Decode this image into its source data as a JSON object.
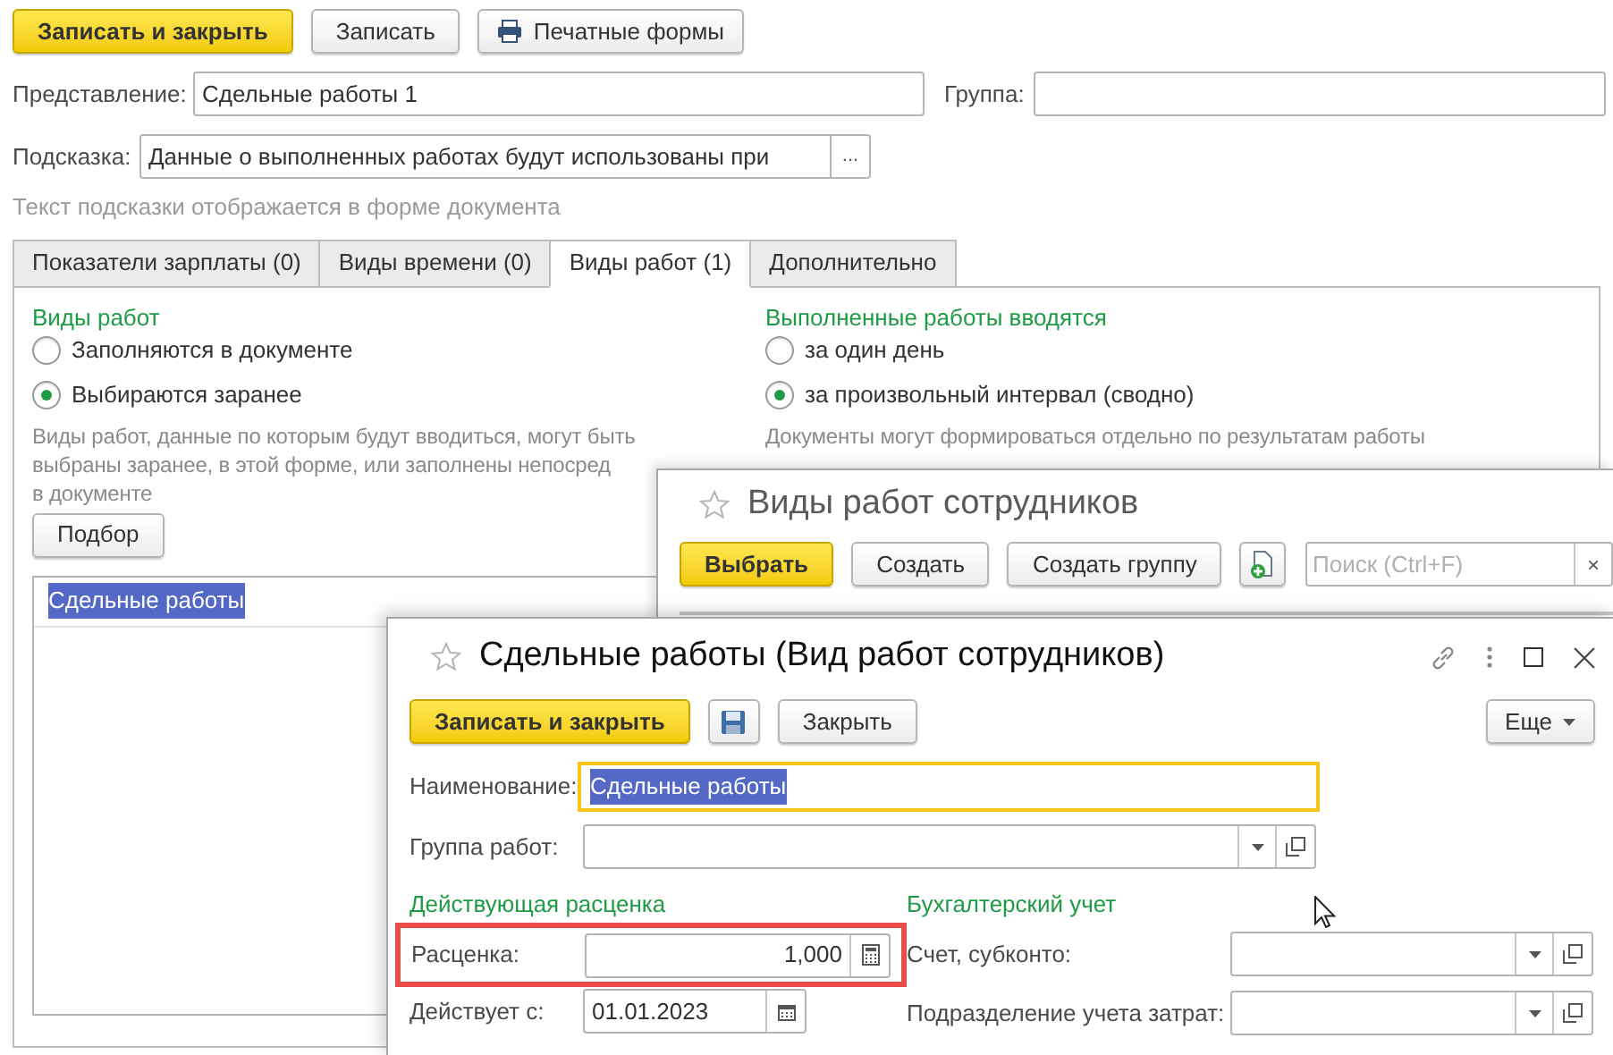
{
  "main": {
    "buttons": [
      {
        "label": "Записать и закрыть",
        "kind": "primary"
      },
      {
        "label": "Записать",
        "kind": "plain"
      },
      {
        "label": "Печатные формы",
        "kind": "print"
      }
    ],
    "representation": {
      "label": "Представление:",
      "value": "Сдельные работы 1"
    },
    "group": {
      "label": "Группа:"
    },
    "hint": {
      "label": "Подсказка:",
      "value": "Данные о выполненных работах будут использованы при",
      "button": "..."
    },
    "hint_note": "Текст подсказки отображается в форме документа",
    "tabs": [
      {
        "label": "Показатели зарплаты (0)",
        "selected": false
      },
      {
        "label": "Виды времени (0)",
        "selected": false
      },
      {
        "label": "Виды работ (1)",
        "selected": true
      },
      {
        "label": "Дополнительно",
        "selected": false
      }
    ],
    "work_types": {
      "title": "Виды работ",
      "options": [
        {
          "label": "Заполняются в документе",
          "selected": false
        },
        {
          "label": "Выбираются заранее",
          "selected": true
        }
      ],
      "description_lines": [
        "Виды работ, данные по которым будут вводиться, могут быть",
        "выбраны заранее, в этой форме, или заполнены непосред",
        "в документе"
      ]
    },
    "entry": {
      "title": "Выполненные работы вводятся",
      "options": [
        {
          "label": "за один день",
          "selected": false
        },
        {
          "label": "за произвольный интервал (сводно)",
          "selected": true
        }
      ],
      "description_lines": [
        "Документы могут формироваться отдельно по результатам работы"
      ]
    },
    "pick_button": "Подбор",
    "list_rows": [
      {
        "label": "Сдельные работы",
        "selected": true
      }
    ]
  },
  "catalog_window": {
    "title": "Виды работ сотрудников",
    "buttons": [
      {
        "label": "Выбрать",
        "kind": "primary"
      },
      {
        "label": "Создать",
        "kind": "plain"
      },
      {
        "label": "Создать группу",
        "kind": "plain"
      },
      {
        "kind": "new_icon"
      }
    ],
    "search": {
      "placeholder": "Поиск (Ctrl+F)",
      "clear": "×"
    }
  },
  "item_window": {
    "title": "Сдельные работы (Вид работ сотрудников)",
    "buttons": [
      {
        "label": "Записать и закрыть",
        "kind": "primary"
      },
      {
        "kind": "save_icon"
      },
      {
        "label": "Закрыть",
        "kind": "plain"
      }
    ],
    "more_button": "Еще",
    "name": {
      "label": "Наименование:",
      "value": "Сдельные работы",
      "value_selected": true
    },
    "work_group": {
      "label": "Группа работ:"
    },
    "rate_section": "Действующая расценка",
    "rate": {
      "label": "Расценка:",
      "value": "1,000",
      "highlighted": true
    },
    "valid_from": {
      "label": "Действует с:",
      "value": "01.01.2023"
    },
    "accounting_section": "Бухгалтерский учет",
    "account": {
      "label": "Счет, субконто:"
    },
    "department": {
      "label": "Подразделение учета затрат:"
    }
  }
}
